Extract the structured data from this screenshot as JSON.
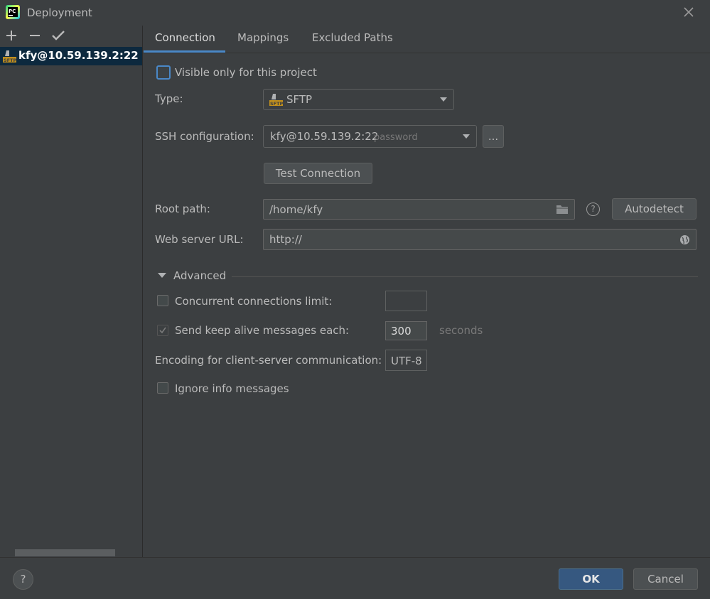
{
  "window": {
    "title": "Deployment"
  },
  "toolbar": {
    "add_symbol": "+",
    "remove_symbol": "−",
    "apply_symbol": "✔"
  },
  "servers": [
    {
      "label": "kfy@10.59.139.2:22 password"
    }
  ],
  "tabs": [
    {
      "label": "Connection",
      "active": true
    },
    {
      "label": "Mappings",
      "active": false
    },
    {
      "label": "Excluded Paths",
      "active": false
    }
  ],
  "connection": {
    "visible_only_label": "Visible only for this project",
    "visible_only_checked": false,
    "type_label": "Type:",
    "type_value": "SFTP",
    "type_badge": "SFTP",
    "ssh_label": "SSH configuration:",
    "ssh_value": "kfy@10.59.139.2:22",
    "ssh_auth": "password",
    "ssh_browse": "...",
    "test_button": "Test Connection",
    "root_label": "Root path:",
    "root_value": "/home/kfy",
    "root_help": "?",
    "autodetect_button": "Autodetect",
    "web_label": "Web server URL:",
    "web_value": "http://"
  },
  "advanced": {
    "title": "Advanced",
    "concurrent_label": "Concurrent connections limit:",
    "concurrent_value": "",
    "keepalive_label": "Send keep alive messages each:",
    "keepalive_value": "300",
    "keepalive_unit": "seconds",
    "keepalive_checked": true,
    "encoding_label": "Encoding for client-server communication:",
    "encoding_value": "UTF-8",
    "ignore_label": "Ignore info messages",
    "ignore_checked": false
  },
  "footer": {
    "help": "?",
    "ok": "OK",
    "cancel": "Cancel"
  },
  "colors": {
    "accent": "#4a88c7",
    "selection": "#0d293e",
    "background": "#3c3f41",
    "primary_button": "#365880"
  }
}
